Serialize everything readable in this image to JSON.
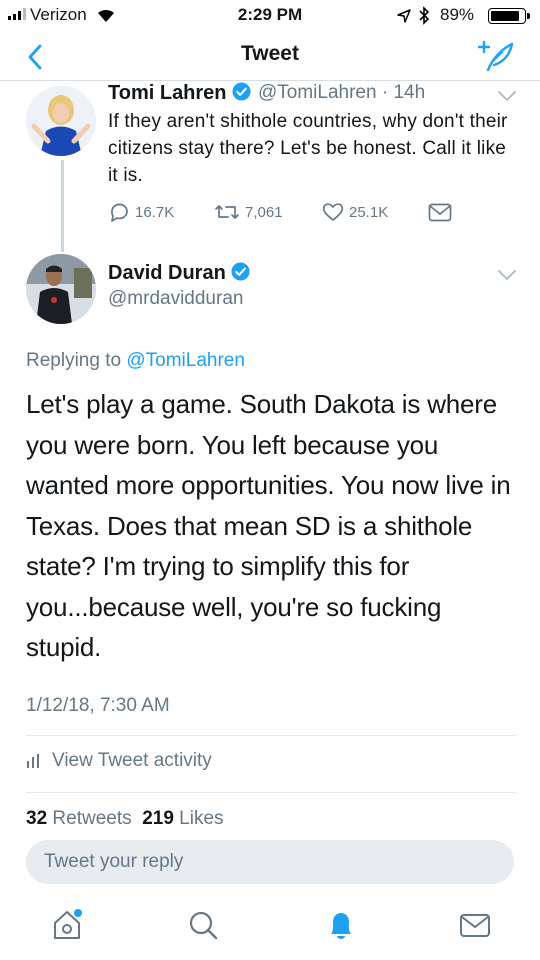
{
  "status": {
    "carrier": "Verizon",
    "time": "2:29 PM",
    "battery": "89%",
    "battery_level": 0.89
  },
  "nav": {
    "title": "Tweet"
  },
  "tweet1": {
    "name": "Tomi Lahren",
    "handle_time": "@TomiLahren · 14h",
    "text": "If they aren't shithole countries, why don't their citizens stay there? Let's be honest. Call it like it is.",
    "replies": "16.7K",
    "retweets": "7,061",
    "likes": "25.1K"
  },
  "tweet2": {
    "name": "David Duran",
    "handle": "@mrdavidduran",
    "replying_prefix": "Replying to",
    "replying_to": "@TomiLahren",
    "text": "Let's play a game. South Dakota is where you were born. You left because you wanted more opportunities. You now live in Texas. Does that mean SD is a shithole state? I'm trying to simplify this for you...because well, you're so fucking stupid.",
    "date": "1/12/18, 7:30 AM",
    "activity_label": "View Tweet activity",
    "retweet_count": "32",
    "retweet_label": "Retweets",
    "like_count": "219",
    "like_label": "Likes"
  },
  "reply": {
    "placeholder": "Tweet your reply"
  },
  "tabs": [
    "home-icon",
    "search-icon",
    "notifications-icon",
    "messages-icon"
  ],
  "colors": {
    "accent": "#1da1f2",
    "muted": "#657786"
  }
}
